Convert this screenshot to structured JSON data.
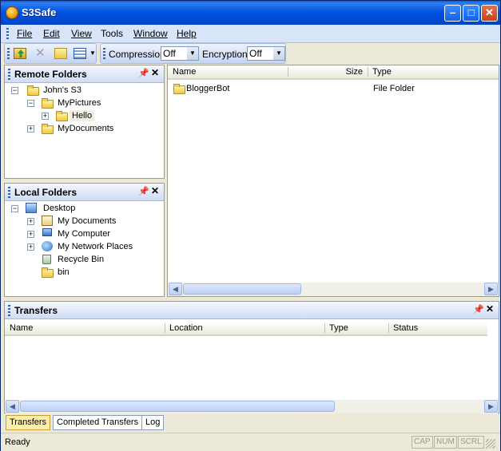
{
  "window": {
    "title": "S3Safe"
  },
  "menu": [
    {
      "label": "File"
    },
    {
      "label": "Edit"
    },
    {
      "label": "View"
    },
    {
      "label": "Tools"
    },
    {
      "label": "Window"
    },
    {
      "label": "Help"
    }
  ],
  "toolbar": {
    "compression_label": "Compression",
    "compression_value": "Off",
    "encryption_label": "Encryption",
    "encryption_value": "Off"
  },
  "remote_folders": {
    "title": "Remote Folders",
    "items": [
      {
        "label": "John's S3"
      },
      {
        "label": "MyPictures"
      },
      {
        "label": "Hello"
      },
      {
        "label": "MyDocuments"
      }
    ]
  },
  "local_folders": {
    "title": "Local Folders",
    "items": [
      {
        "label": "Desktop"
      },
      {
        "label": "My Documents"
      },
      {
        "label": "My Computer"
      },
      {
        "label": "My Network Places"
      },
      {
        "label": "Recycle Bin"
      },
      {
        "label": "bin"
      }
    ]
  },
  "file_list": {
    "columns": {
      "name": "Name",
      "size": "Size",
      "type": "Type"
    },
    "rows": [
      {
        "name": "BloggerBot",
        "size": "",
        "type": "File Folder"
      }
    ]
  },
  "transfers": {
    "title": "Transfers",
    "columns": {
      "name": "Name",
      "location": "Location",
      "type": "Type",
      "status": "Status"
    }
  },
  "tabs": [
    {
      "label": "Transfers"
    },
    {
      "label": "Completed Transfers"
    },
    {
      "label": "Log"
    }
  ],
  "status": {
    "text": "Ready",
    "cap": "CAP",
    "num": "NUM",
    "scrl": "SCRL"
  }
}
